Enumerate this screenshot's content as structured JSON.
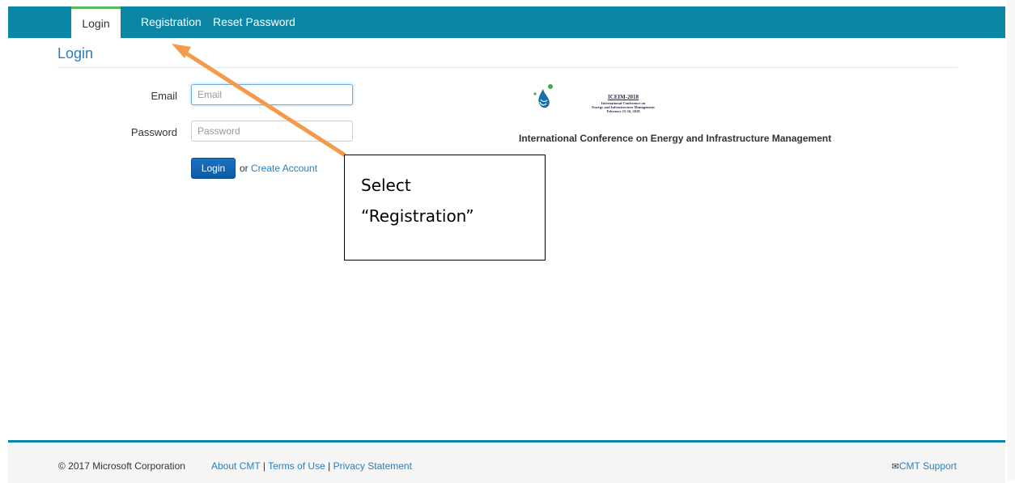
{
  "nav": {
    "tabs": [
      {
        "label": "Login",
        "active": true
      },
      {
        "label": "Registration",
        "active": false
      },
      {
        "label": "Reset Password",
        "active": false
      }
    ]
  },
  "page": {
    "title": "Login"
  },
  "form": {
    "email_label": "Email",
    "email_placeholder": "Email",
    "password_label": "Password",
    "password_placeholder": "Password",
    "login_button": "Login",
    "or_text": "or",
    "create_account": "Create Account"
  },
  "conference": {
    "acronym": "ICEIM-2018",
    "subtitle_line1": "International Conference on",
    "subtitle_line2": "Energy and Infrastructure Management",
    "subtitle_line3": "February 15-16, 2018",
    "full_title": "International Conference on Energy and Infrastructure Management"
  },
  "annotation": {
    "line1": "Select",
    "line2": "“Registration”",
    "arrow_color": "#f39a4c"
  },
  "footer": {
    "copyright": "© 2017 Microsoft Corporation",
    "about": "About CMT",
    "terms": "Terms of Use",
    "privacy": "Privacy Statement",
    "separator": "|",
    "support": "CMT Support",
    "support_icon": "envelope-icon"
  },
  "colors": {
    "nav_bg": "#0c86a5",
    "link": "#2a7fb8",
    "active_tab_accent": "#5cb85c"
  }
}
